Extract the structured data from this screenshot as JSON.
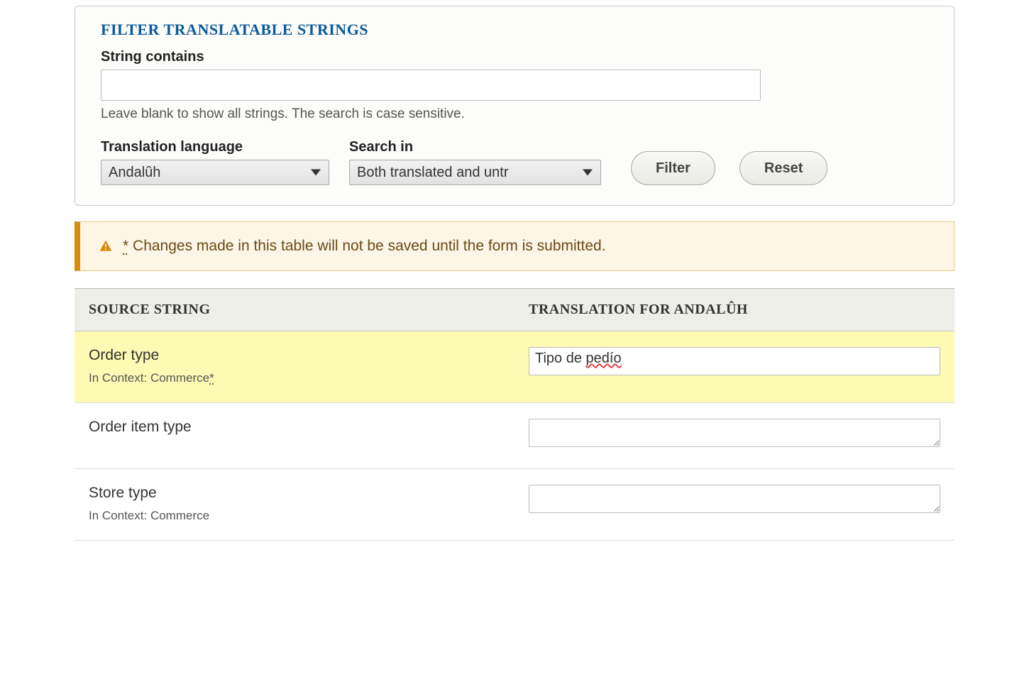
{
  "filter": {
    "legend": "FILTER TRANSLATABLE STRINGS",
    "string_contains_label": "String contains",
    "string_contains_value": "",
    "string_contains_help": "Leave blank to show all strings. The search is case sensitive.",
    "translation_language_label": "Translation language",
    "translation_language_value": "Andalûh",
    "search_in_label": "Search in",
    "search_in_value": "Both translated and untr",
    "filter_button": "Filter",
    "reset_button": "Reset"
  },
  "warning": {
    "prefix": "*",
    "text": "Changes made in this table will not be saved until the form is submitted."
  },
  "table": {
    "head_source": "SOURCE STRING",
    "head_translation": "TRANSLATION FOR ANDALÛH",
    "context_prefix": "In Context: ",
    "rows": [
      {
        "source": "Order type",
        "context": "Commerce",
        "context_marked": "*",
        "translation_prefix": "Tipo de ",
        "translation_spell": "pedío",
        "highlight": true
      },
      {
        "source": "Order item type",
        "context": "",
        "context_marked": "",
        "translation_prefix": "",
        "translation_spell": "",
        "highlight": false
      },
      {
        "source": "Store type",
        "context": "Commerce",
        "context_marked": "",
        "translation_prefix": "",
        "translation_spell": "",
        "highlight": false
      }
    ]
  }
}
